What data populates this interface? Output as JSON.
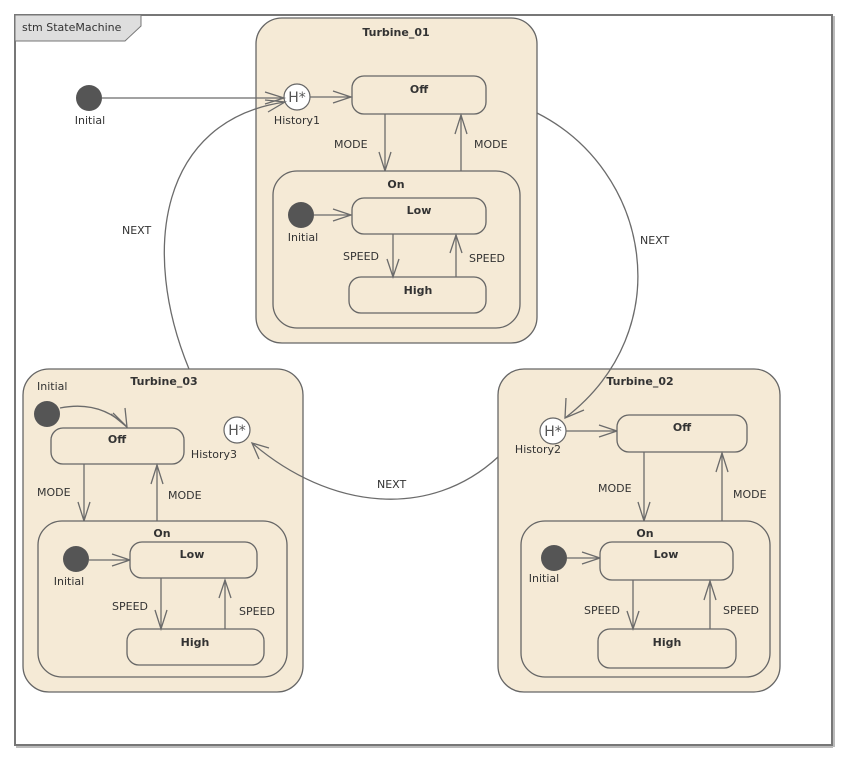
{
  "frame": {
    "title": "stm StateMachine"
  },
  "top_initial": {
    "label": "Initial"
  },
  "turbines": [
    {
      "name": "Turbine_01",
      "history": {
        "symbol": "H*",
        "label": "History1"
      },
      "off": "Off",
      "on": "On",
      "low": "Low",
      "high": "High",
      "inner_initial": "Initial",
      "mode_down": "MODE",
      "mode_up": "MODE",
      "speed_down": "SPEED",
      "speed_up": "SPEED"
    },
    {
      "name": "Turbine_02",
      "history": {
        "symbol": "H*",
        "label": "History2"
      },
      "off": "Off",
      "on": "On",
      "low": "Low",
      "high": "High",
      "inner_initial": "Initial",
      "mode_down": "MODE",
      "mode_up": "MODE",
      "speed_down": "SPEED",
      "speed_up": "SPEED"
    },
    {
      "name": "Turbine_03",
      "history": {
        "symbol": "H*",
        "label": "History3"
      },
      "initial": "Initial",
      "off": "Off",
      "on": "On",
      "low": "Low",
      "high": "High",
      "inner_initial": "Initial",
      "mode_down": "MODE",
      "mode_up": "MODE",
      "speed_down": "SPEED",
      "speed_up": "SPEED"
    }
  ],
  "transitions": {
    "t1_to_t2": "NEXT",
    "t2_to_t3": "NEXT",
    "t3_to_t1": "NEXT"
  }
}
